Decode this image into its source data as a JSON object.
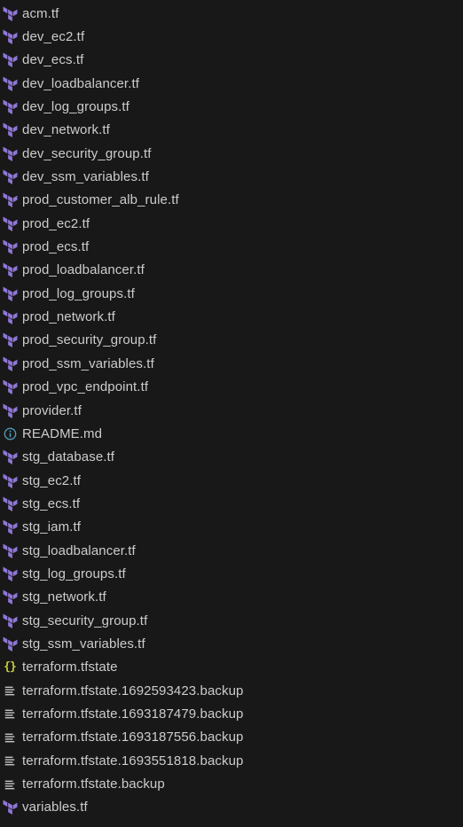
{
  "explorer": {
    "files": [
      {
        "name": "acm.tf",
        "icon": "terraform-icon"
      },
      {
        "name": "dev_ec2.tf",
        "icon": "terraform-icon"
      },
      {
        "name": "dev_ecs.tf",
        "icon": "terraform-icon"
      },
      {
        "name": "dev_loadbalancer.tf",
        "icon": "terraform-icon"
      },
      {
        "name": "dev_log_groups.tf",
        "icon": "terraform-icon"
      },
      {
        "name": "dev_network.tf",
        "icon": "terraform-icon"
      },
      {
        "name": "dev_security_group.tf",
        "icon": "terraform-icon"
      },
      {
        "name": "dev_ssm_variables.tf",
        "icon": "terraform-icon"
      },
      {
        "name": "prod_customer_alb_rule.tf",
        "icon": "terraform-icon"
      },
      {
        "name": "prod_ec2.tf",
        "icon": "terraform-icon"
      },
      {
        "name": "prod_ecs.tf",
        "icon": "terraform-icon"
      },
      {
        "name": "prod_loadbalancer.tf",
        "icon": "terraform-icon"
      },
      {
        "name": "prod_log_groups.tf",
        "icon": "terraform-icon"
      },
      {
        "name": "prod_network.tf",
        "icon": "terraform-icon"
      },
      {
        "name": "prod_security_group.tf",
        "icon": "terraform-icon"
      },
      {
        "name": "prod_ssm_variables.tf",
        "icon": "terraform-icon"
      },
      {
        "name": "prod_vpc_endpoint.tf",
        "icon": "terraform-icon"
      },
      {
        "name": "provider.tf",
        "icon": "terraform-icon"
      },
      {
        "name": "README.md",
        "icon": "info-icon"
      },
      {
        "name": "stg_database.tf",
        "icon": "terraform-icon"
      },
      {
        "name": "stg_ec2.tf",
        "icon": "terraform-icon"
      },
      {
        "name": "stg_ecs.tf",
        "icon": "terraform-icon"
      },
      {
        "name": "stg_iam.tf",
        "icon": "terraform-icon"
      },
      {
        "name": "stg_loadbalancer.tf",
        "icon": "terraform-icon"
      },
      {
        "name": "stg_log_groups.tf",
        "icon": "terraform-icon"
      },
      {
        "name": "stg_network.tf",
        "icon": "terraform-icon"
      },
      {
        "name": "stg_security_group.tf",
        "icon": "terraform-icon"
      },
      {
        "name": "stg_ssm_variables.tf",
        "icon": "terraform-icon"
      },
      {
        "name": "terraform.tfstate",
        "icon": "json-braces-icon"
      },
      {
        "name": "terraform.tfstate.1692593423.backup",
        "icon": "text-lines-icon"
      },
      {
        "name": "terraform.tfstate.1693187479.backup",
        "icon": "text-lines-icon"
      },
      {
        "name": "terraform.tfstate.1693187556.backup",
        "icon": "text-lines-icon"
      },
      {
        "name": "terraform.tfstate.1693551818.backup",
        "icon": "text-lines-icon"
      },
      {
        "name": "terraform.tfstate.backup",
        "icon": "text-lines-icon"
      },
      {
        "name": "variables.tf",
        "icon": "terraform-icon"
      }
    ]
  },
  "colors": {
    "background": "#181818",
    "text": "#cccccc",
    "terraform": "#8f76d6",
    "info": "#519aba",
    "json": "#cbcb41",
    "lines": "#c5c5c5"
  }
}
